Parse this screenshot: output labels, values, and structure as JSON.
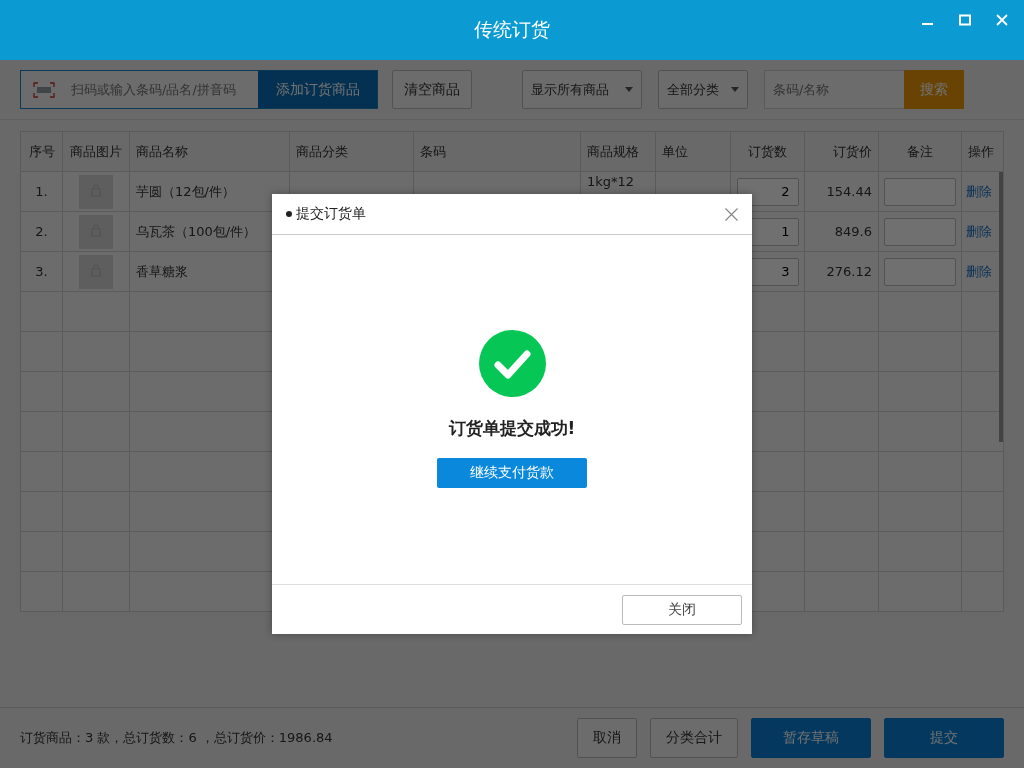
{
  "window": {
    "title": "传统订货"
  },
  "toolbar": {
    "scan_field": {
      "placeholder": "扫码或输入条码/品名/拼音码"
    },
    "add_button": "添加订货商品",
    "clear_button": "清空商品",
    "filter_select": "显示所有商品",
    "category_select": "全部分类",
    "search_field": {
      "placeholder": "条码/名称"
    },
    "search_button": "搜索"
  },
  "table": {
    "columns": [
      "序号",
      "商品图片",
      "商品名称",
      "商品分类",
      "条码",
      "商品规格",
      "单位",
      "订货数",
      "订货价",
      "备注",
      "操作"
    ],
    "rows": [
      {
        "index": "1.",
        "name": "芋圆（12包/件）",
        "spec": "1kg*12",
        "quantity": "2",
        "price": "154.44",
        "action": "删除"
      },
      {
        "index": "2.",
        "name": "乌瓦茶（100包/件）",
        "quantity": "1",
        "price": "849.6",
        "action": "删除"
      },
      {
        "index": "3.",
        "name": "香草糖浆",
        "quantity": "3",
        "price": "276.12",
        "action": "删除"
      }
    ]
  },
  "footer": {
    "summary": "订货商品：3 款，总订货数：6 ，总订货价：1986.84",
    "buttons": [
      {
        "label": "取消",
        "kind": "default"
      },
      {
        "label": "分类合计",
        "kind": "default"
      },
      {
        "label": "暂存草稿",
        "kind": "primary"
      },
      {
        "label": "提交",
        "kind": "primary"
      }
    ]
  },
  "dialog": {
    "title": "提交订货单",
    "message": "订货单提交成功!",
    "pay_button": "继续支付货款",
    "close_button": "关闭"
  }
}
